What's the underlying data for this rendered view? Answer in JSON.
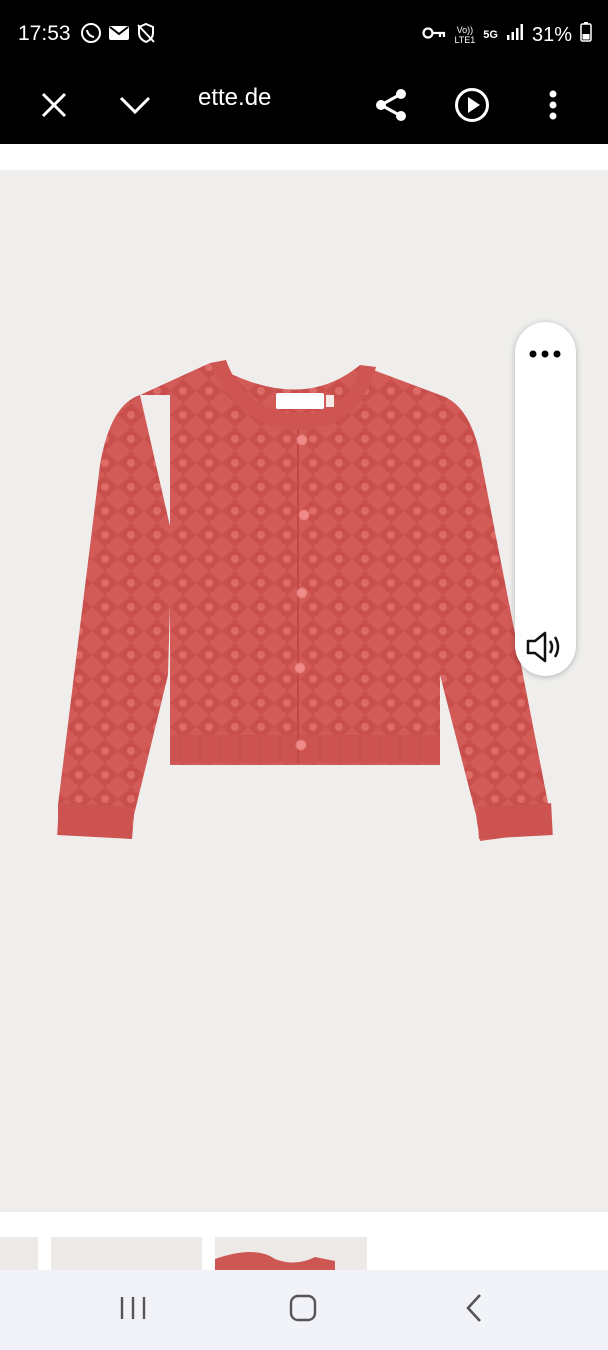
{
  "status_bar": {
    "time": "17:53",
    "battery": "31%",
    "network_label_1": "Vo))",
    "network_label_2": "LTE1",
    "network_label_3": "5G",
    "icons": [
      "whatsapp-icon",
      "gmail-icon",
      "shield-icon",
      "vpn-key-icon",
      "signal-icon",
      "battery-icon"
    ]
  },
  "browser_toolbar": {
    "url": "ette.de",
    "icons": [
      "close-icon",
      "chevron-down-icon",
      "share-icon",
      "play-icon",
      "more-vert-icon"
    ]
  },
  "floating_panel": {
    "icons": [
      "more-horiz-icon",
      "volume-icon"
    ]
  },
  "product": {
    "image": "red-knit-cardigan",
    "color": "#d25a57"
  },
  "nav_bar": {
    "icons": [
      "recent-apps-icon",
      "home-icon",
      "back-icon"
    ]
  },
  "colors": {
    "status_bg": "#000000",
    "product_bg": "#efeeec",
    "nav_bg": "#f1f3f8"
  }
}
